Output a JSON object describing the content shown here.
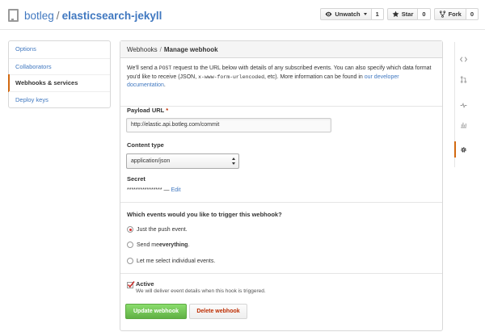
{
  "repo": {
    "owner": "botleg",
    "separator": "/",
    "name": "elasticsearch-jekyll"
  },
  "actions": {
    "watch": {
      "label": "Unwatch",
      "count": "1"
    },
    "star": {
      "label": "Star",
      "count": "0"
    },
    "fork": {
      "label": "Fork",
      "count": "0"
    }
  },
  "menu": {
    "items": [
      {
        "label": "Options"
      },
      {
        "label": "Collaborators"
      },
      {
        "label": "Webhooks & services"
      },
      {
        "label": "Deploy keys"
      }
    ]
  },
  "breadcrumb": {
    "parent": "Webhooks",
    "separator": "/",
    "current": "Manage webhook"
  },
  "intro": {
    "part1": "We'll send a ",
    "code1": "POST",
    "part2": " request to the URL below with details of any subscribed events. You can also specify which data format you'd like to receive (JSON, ",
    "code2": "x-www-form-urlencoded",
    "part3": ", etc). More information can be found in ",
    "link": "our developer documentation",
    "part4": "."
  },
  "payload": {
    "label": "Payload URL",
    "required_mark": "*",
    "value": "http://elastic.api.botleg.com/commit"
  },
  "content_type": {
    "label": "Content type",
    "value": "application/json"
  },
  "secret": {
    "label": "Secret",
    "masked": "****************",
    "dash": "—",
    "edit": "Edit"
  },
  "events": {
    "question": "Which events would you like to trigger this webhook?",
    "opt1": "Just the push event.",
    "opt2_prefix": "Send me ",
    "opt2_bold": "everything",
    "opt2_suffix": ".",
    "opt3": "Let me select individual events."
  },
  "active": {
    "label": "Active",
    "desc": "We will deliver event details when this hook is triggered."
  },
  "buttons": {
    "update": "Update webhook",
    "delete": "Delete webhook"
  },
  "colors": {
    "accent": "#d26911",
    "link": "#4078c0",
    "primary": "#6cc644",
    "danger": "#bd2c00"
  }
}
